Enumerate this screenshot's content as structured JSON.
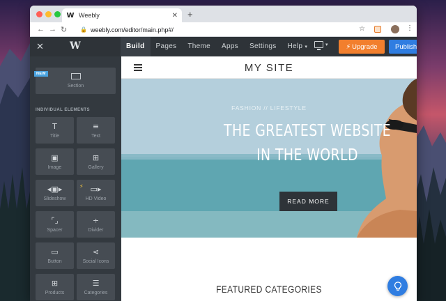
{
  "browser": {
    "tab_title": "Weebly",
    "tab_favicon": "W",
    "url": "weebly.com/editor/main.php#/"
  },
  "toolbar": {
    "menu": [
      "Build",
      "Pages",
      "Theme",
      "Apps",
      "Settings",
      "Help"
    ],
    "active": "Build",
    "upgrade_label": "Upgrade",
    "publish_label": "Publish",
    "colors": {
      "upgrade": "#f27f2d",
      "publish": "#2f7de1",
      "bar": "#2e3338"
    }
  },
  "sidebar": {
    "new_badge": "NEW",
    "section_label": "Section",
    "heading": "INDIVIDUAL ELEMENTS",
    "elements": [
      {
        "label": "Title",
        "icon": "text-title-icon"
      },
      {
        "label": "Text",
        "icon": "text-lines-icon"
      },
      {
        "label": "Image",
        "icon": "image-icon"
      },
      {
        "label": "Gallery",
        "icon": "gallery-grid-icon"
      },
      {
        "label": "Slideshow",
        "icon": "slideshow-icon"
      },
      {
        "label": "HD Video",
        "icon": "video-icon"
      },
      {
        "label": "Spacer",
        "icon": "spacer-icon"
      },
      {
        "label": "Divider",
        "icon": "divider-icon"
      },
      {
        "label": "Button",
        "icon": "button-icon"
      },
      {
        "label": "Social Icons",
        "icon": "share-icon"
      },
      {
        "label": "Products",
        "icon": "products-icon"
      },
      {
        "label": "Categories",
        "icon": "categories-icon"
      }
    ]
  },
  "site": {
    "title": "MY SITE",
    "hero_kicker": "FASHION // LIFESTYLE",
    "hero_line1": "THE GREATEST WEBSITE",
    "hero_line2": "IN THE WORLD",
    "cta_label": "READ MORE",
    "featured_heading": "FEATURED CATEGORIES"
  }
}
